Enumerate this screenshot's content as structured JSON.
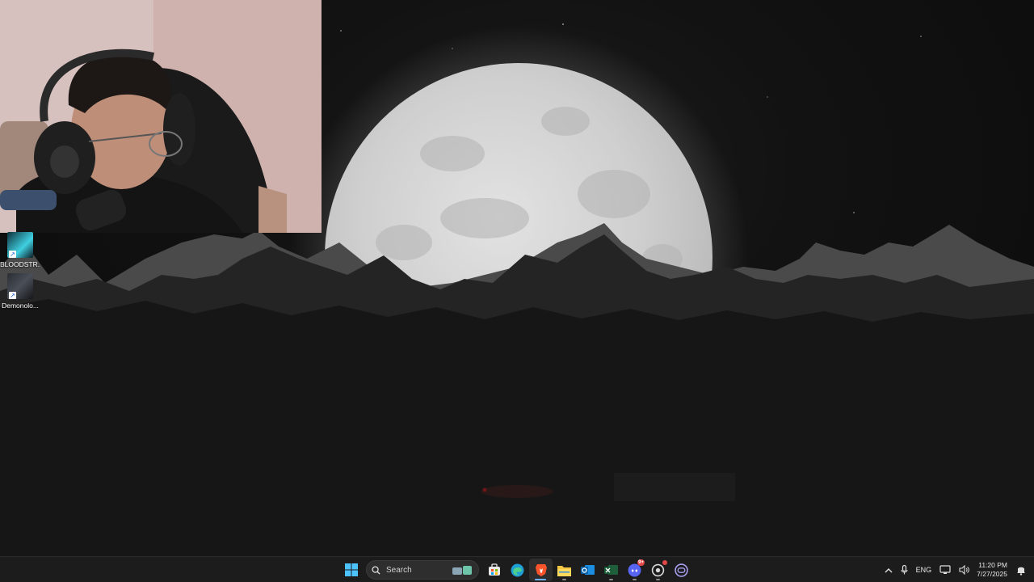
{
  "desktop": {
    "icons": [
      {
        "label": "BLOODSTR...",
        "icon": "game-shortcut-icon"
      },
      {
        "label": "Demonolo...",
        "icon": "game-shortcut-icon"
      }
    ]
  },
  "taskbar": {
    "search_placeholder": "Search",
    "apps": [
      {
        "name": "start",
        "icon": "windows-logo-icon"
      },
      {
        "name": "microsoft-store",
        "icon": "store-icon"
      },
      {
        "name": "edge",
        "icon": "edge-icon"
      },
      {
        "name": "brave",
        "icon": "brave-icon",
        "active": true
      },
      {
        "name": "file-explorer",
        "icon": "folder-icon"
      },
      {
        "name": "outlook",
        "icon": "outlook-icon"
      },
      {
        "name": "excel",
        "icon": "excel-icon"
      },
      {
        "name": "discord",
        "icon": "discord-icon",
        "badge": "9+"
      },
      {
        "name": "steam-like-app",
        "icon": "app-icon"
      },
      {
        "name": "copilot",
        "icon": "copilot-icon"
      }
    ],
    "tray": {
      "language": "ENG",
      "time": "11:20 PM",
      "date": "7/27/2025"
    }
  },
  "colors": {
    "accent": "#6fb1ff",
    "taskbar_bg": "#1c1c1c",
    "notification_badge": "#e24747"
  }
}
